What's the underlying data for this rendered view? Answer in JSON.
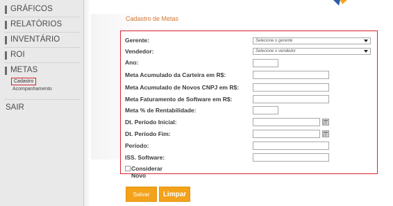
{
  "sidebar": {
    "items": [
      {
        "label": "GRÁFICOS"
      },
      {
        "label": "RELATÓRIOS"
      },
      {
        "label": "INVENTÁRIO"
      },
      {
        "label": "ROI"
      },
      {
        "label": "METAS"
      }
    ],
    "subitems": [
      {
        "label": "Cadastro"
      },
      {
        "label": "Acompanhamento"
      }
    ],
    "sair_label": "SAIR"
  },
  "page": {
    "title": "Cadastro de Metas"
  },
  "form": {
    "gerente": {
      "label": "Gerente:",
      "value": "Selecione o gerente"
    },
    "vendedor": {
      "label": "Vendedor:",
      "value": "Selecione o vendedor"
    },
    "ano": {
      "label": "Ano:"
    },
    "meta_carteira": {
      "label": "Meta Acumulado da Carteira em R$:"
    },
    "meta_cnpj": {
      "label": "Meta Acumulado de Novos CNPJ em R$:"
    },
    "meta_software": {
      "label": "Meta Faturamento de Software em R$:"
    },
    "meta_rentabilidade": {
      "label": "Meta % de Rentabilidade:"
    },
    "dt_inicial": {
      "label": "Dt. Período Inicial:"
    },
    "dt_fim": {
      "label": "Dt. Período Fim:"
    },
    "periodo": {
      "label": "Período:"
    },
    "iss_software": {
      "label": "ISS. Software:"
    },
    "considerar_novo": {
      "label": "Considerar Novo",
      "checked": false
    }
  },
  "buttons": {
    "salvar": "Salvar",
    "limpar": "Limpar"
  },
  "colors": {
    "accent": "#f3a219",
    "title": "#d4752d",
    "highlight": "#d8232f"
  }
}
